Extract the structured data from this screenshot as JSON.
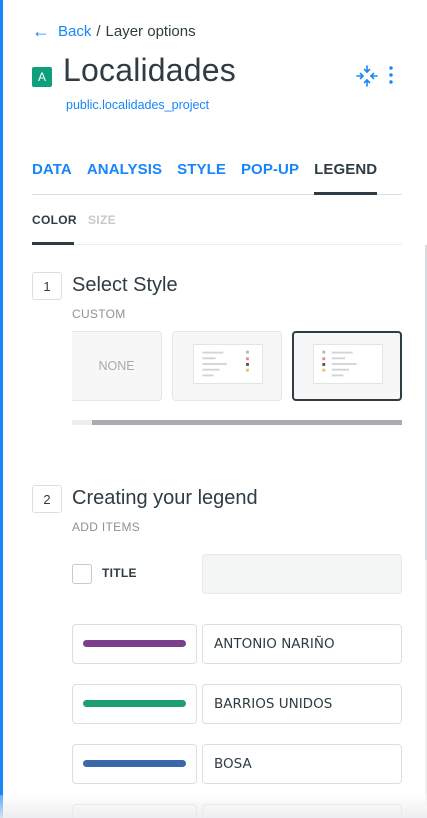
{
  "header": {
    "back_label": "Back",
    "separator": "/",
    "current": "Layer options",
    "layer_badge": "A",
    "layer_name": "Localidades",
    "layer_source": "public.localidades_project"
  },
  "tabs": [
    {
      "label": "DATA",
      "active": false
    },
    {
      "label": "ANALYSIS",
      "active": false
    },
    {
      "label": "STYLE",
      "active": false
    },
    {
      "label": "POP-UP",
      "active": false
    },
    {
      "label": "LEGEND",
      "active": true
    }
  ],
  "subtabs": [
    {
      "label": "COLOR",
      "state": "active"
    },
    {
      "label": "SIZE",
      "state": "disabled"
    }
  ],
  "step1": {
    "number": "1",
    "title": "Select Style",
    "subtitle": "CUSTOM",
    "none_label": "NONE"
  },
  "step2": {
    "number": "2",
    "title": "Creating your legend",
    "subtitle": "ADD ITEMS",
    "title_label": "TITLE",
    "title_value": ""
  },
  "legend_items": [
    {
      "name": "ANTONIO NARIÑO",
      "color": "#7b3f8c"
    },
    {
      "name": "BARRIOS UNIDOS",
      "color": "#1c9e77"
    },
    {
      "name": "BOSA",
      "color": "#3969ac"
    }
  ],
  "colors": {
    "accent": "#1785fb",
    "text": "#2e3c43",
    "badge": "#0fa07b"
  }
}
